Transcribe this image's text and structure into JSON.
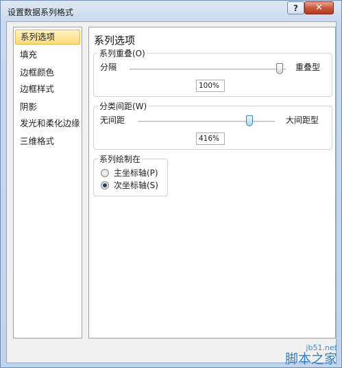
{
  "window": {
    "title": "设置数据系列格式",
    "help_label": "?",
    "close_label": "✕"
  },
  "sidebar": {
    "items": [
      {
        "label": "系列选项",
        "selected": true
      },
      {
        "label": "填充"
      },
      {
        "label": "边框颜色"
      },
      {
        "label": "边框样式"
      },
      {
        "label": "阴影"
      },
      {
        "label": "发光和柔化边缘"
      },
      {
        "label": "三维格式"
      }
    ]
  },
  "content": {
    "title": "系列选项",
    "overlap": {
      "label": "系列重叠(O)",
      "min_label": "分隔",
      "max_label": "重叠型",
      "value": "100%",
      "slider_fraction": 1.0
    },
    "gap": {
      "label": "分类间距(W)",
      "min_label": "无间距",
      "max_label": "大间距型",
      "value": "416%",
      "slider_fraction": 0.83
    },
    "plot_on": {
      "label": "系列绘制在",
      "options": [
        {
          "label": "主坐标轴(P)",
          "checked": false
        },
        {
          "label": "次坐标轴(S)",
          "checked": true
        }
      ]
    }
  },
  "watermark": {
    "site": "jb51.net",
    "name": "脚本之家"
  }
}
